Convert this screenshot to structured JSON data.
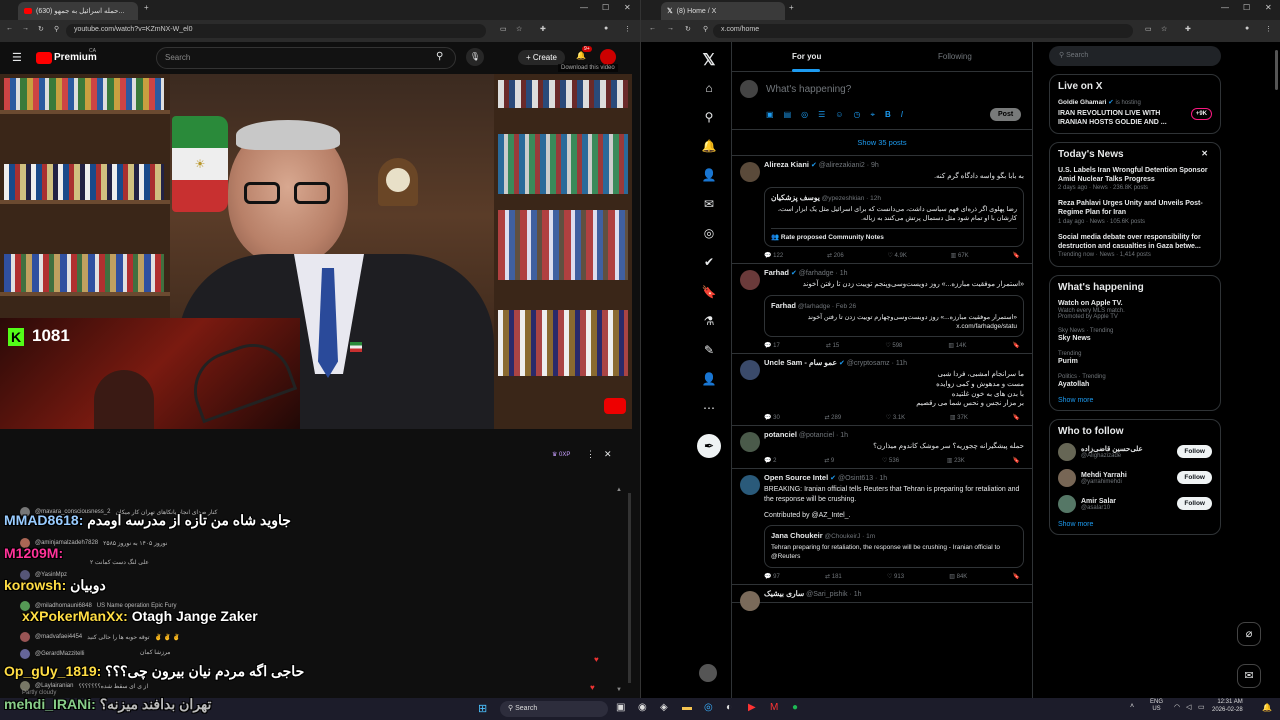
{
  "left_browser": {
    "tab_title": "(630) حمله اسرائیل به جمهو...",
    "url": "youtube.com/watch?v=KZmNX-W_el0"
  },
  "youtube": {
    "brand": "Premium",
    "brand_sup": "CA",
    "search_placeholder": "Search",
    "create_label": "Create",
    "notif_badge": "9+",
    "tooltip": "Download this video",
    "stream_counter": "1081",
    "xp_label": "0XP",
    "colors": {
      "red": "#ff0000",
      "kick_green": "#53fc18"
    }
  },
  "chat": {
    "messages": [
      {
        "user": "@mavara_consciousness_2",
        "text": "کنار صدای انجار یانکاهای تهران کار میکان"
      },
      {
        "user": "@aminjamalzadeh7828",
        "text": "نوروز ۱۴۰۵ به نوروز ۲۵۸۵"
      },
      {
        "user": "",
        "text": "علی لنگ دست کمانت ۲"
      },
      {
        "user": "@YasinMpz",
        "text": ""
      },
      {
        "user": "@miladhomauni6848",
        "text": "US Name operation Epic Fury"
      },
      {
        "user": "@madvafaei4454",
        "text": "توقه حوبه ها را حالی کنید"
      },
      {
        "user": "",
        "text": "مرزشا کمان"
      },
      {
        "user": "@GerardMazzitelli",
        "text": ""
      },
      {
        "user": "@Laylairanian",
        "text": "از ی ای سقط شده؟؟؟؟؟؟؟"
      }
    ],
    "overlays": [
      {
        "user": "MMAD8618:",
        "text": "جاوید شاه من تازه از مدرسه اومدم"
      },
      {
        "user": "M1209M:",
        "text": ""
      },
      {
        "user": "korowsh:",
        "text": "دوبیان"
      },
      {
        "user": "xXPokerManXx:",
        "text": "Otagh Jange Zaker"
      },
      {
        "user": "Op_gUy_1819:",
        "text": "حاجی اگه مردم نیان بیرون چی؟؟؟"
      },
      {
        "user": "mehdi_IRANi:",
        "text": "تهران بدافند میزنه؟"
      }
    ],
    "footer_text": "Partly cloudy"
  },
  "right_browser": {
    "tab_title": "(8) Home / X",
    "url": "x.com/home"
  },
  "x": {
    "tabs": [
      "For you",
      "Following"
    ],
    "composer_placeholder": "What's happening?",
    "post_button": "Post",
    "show_posts": "Show 35 posts",
    "tweets": [
      {
        "name": "Alireza Kiani",
        "handle": "@alirezakiani2 · 9h",
        "text": "به بابا بگو واسه دادگاه گرم کنه.",
        "quote": {
          "name": "یوسف پزشکیان",
          "handle": "@ypezeshkian · 12h",
          "text": "رضا پهلوی اگر ذره‌ای فهم سیاسی داشت، می‌دانست که برای اسرائیل مثل یک ابزار است، کارشان با او تمام شود مثل دستمال پرتش می‌کنند به زباله."
        },
        "community": "Rate proposed Community Notes",
        "stats": [
          "122",
          "206",
          "4.9K",
          "67K"
        ]
      },
      {
        "name": "Farhad",
        "handle": "@farhadge · 1h",
        "text": "«استمرار موفقیت مبارزه...» روز دویست‌وسی‌وپنجم توییت زدن تا رفتن آخوند",
        "quote": {
          "name": "Farhad",
          "handle": "@farhadge · Feb 26",
          "text": "«استمرار موفقیت مبارزه...» روز دویست‌وسی‌وچهارم توییت زدن تا رفتن آخوند x.com/farhadge/statu"
        },
        "stats": [
          "17",
          "15",
          "598",
          "14K"
        ]
      },
      {
        "name": "Uncle Sam - عمو سام",
        "handle": "@cryptosamz · 11h",
        "lines": [
          "ما سرانجام امشبی، فردا شبی",
          "مست و مدهوش و کمی زوایده",
          "با بدن های به خون غلتیده",
          "بر مزار نجس و نحس شما می رقصیم"
        ],
        "stats": [
          "30",
          "289",
          "3.1K",
          "37K"
        ]
      },
      {
        "name": "potanciel",
        "handle": "@potanciel · 1h",
        "text": "حمله پیشگیرانه چجوریه؟ سر موشک کاندوم میذارن؟",
        "stats": [
          "2",
          "9",
          "536",
          "23K"
        ]
      },
      {
        "name": "Open Source Intel",
        "handle": "@Osint613 · 1h",
        "text": "BREAKING: Iranian official tells Reuters that Tehran is preparing for retaliation and the response will be crushing.",
        "contrib": "Contributed by @AZ_Intel_.",
        "quote": {
          "name": "Jana Choukeir",
          "handle": "@ChoukeirJ · 1m",
          "text": "Tehran preparing for retaliation, the response will be crushing - Iranian official to @Reuters"
        },
        "stats": [
          "97",
          "181",
          "913",
          "84K"
        ]
      },
      {
        "name": "ساری بیشیک",
        "handle": "@Sari_pishik · 1h",
        "text": ""
      }
    ],
    "search_placeholder": "Search",
    "live": {
      "title": "Live on X",
      "host": "Goldie Ghamari",
      "host_tag": "is hosting",
      "text": "IRAN REVOLUTION LIVE WITH IRANIAN HOSTS GOLDIE AND ...",
      "badge": "+9K"
    },
    "news": {
      "title": "Today's News",
      "items": [
        {
          "headline": "U.S. Labels Iran Wrongful Detention Sponsor Amid Nuclear Talks Progress",
          "meta": "2 days ago · News · 236.8K posts"
        },
        {
          "headline": "Reza Pahlavi Urges Unity and Unveils Post-Regime Plan for Iran",
          "meta": "1 day ago · News · 105.6K posts"
        },
        {
          "headline": "Social media debate over responsibility for destruction and casualties in Gaza betwe...",
          "meta": "Trending now · News · 1,414 posts"
        }
      ]
    },
    "happening": {
      "title": "What's happening",
      "items": [
        {
          "context": "",
          "topic": "Watch on Apple TV.",
          "sub": "Watch every MLS match.",
          "promo": "Promoted by Apple TV"
        },
        {
          "context": "Sky News · Trending",
          "topic": "Sky News",
          "sub": "",
          "promo": ""
        },
        {
          "context": "Trending",
          "topic": "Purim",
          "sub": "",
          "promo": ""
        },
        {
          "context": "Politics · Trending",
          "topic": "Ayatollah",
          "sub": "",
          "promo": ""
        }
      ],
      "show_more": "Show more"
    },
    "follow": {
      "title": "Who to follow",
      "items": [
        {
          "name": "علی‌حسین قاضی‌زاده",
          "handle": "@Alighazizade"
        },
        {
          "name": "Mehdi Yarrahi",
          "handle": "@yarrahimehdi"
        },
        {
          "name": "Amir Salar",
          "handle": "@asalar10"
        }
      ],
      "button": "Follow",
      "show_more": "Show more"
    },
    "colors": {
      "blue": "#1d9bf0",
      "bg": "#000000"
    }
  },
  "taskbar": {
    "search": "Search",
    "lang": "ENG",
    "lang2": "US",
    "time": "12:31 AM",
    "date": "2026-02-28"
  }
}
